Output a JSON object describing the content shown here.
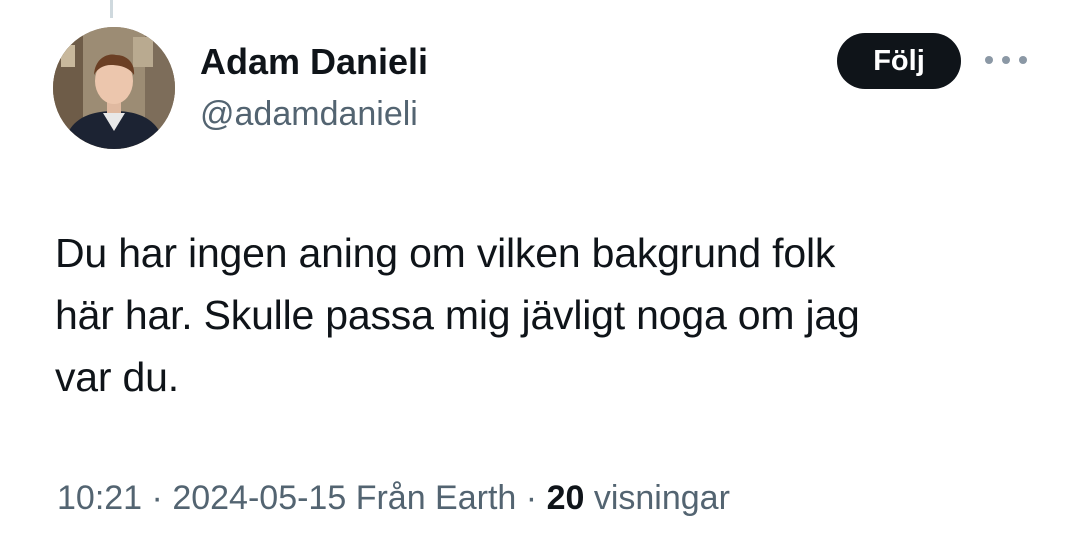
{
  "author": {
    "name": "Adam Danieli",
    "handle": "@adamdanieli"
  },
  "follow_button": {
    "label": "Följ"
  },
  "more_icon": "more-horizontal-icon",
  "tweet": {
    "lines": [
      "Du har ingen aning om vilken bakgrund folk",
      "här har. Skulle passa mig jävligt noga om jag",
      "var du."
    ]
  },
  "meta": {
    "time": "10:21",
    "separator": "·",
    "date": "2024-05-15",
    "source": "Från Earth",
    "views_count": "20",
    "views_label": "visningar"
  },
  "colors": {
    "text_primary": "#0f1419",
    "text_secondary": "#536471",
    "button_bg": "#0f1419",
    "button_text": "#ffffff"
  }
}
